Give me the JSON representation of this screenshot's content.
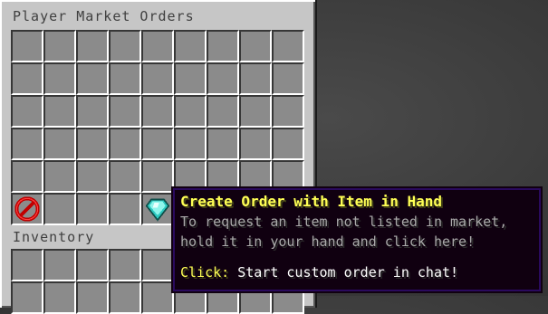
{
  "window": {
    "title": "Player Market Orders",
    "inventory_label": "Inventory"
  },
  "slots": {
    "barrier_slot": {
      "icon": "barrier-icon"
    },
    "create_order_slot": {
      "icon": "diamond-icon"
    }
  },
  "tooltip": {
    "title": "Create Order with Item in Hand",
    "lines": [
      "To request an item not listed in market,",
      "hold it in your hand and click here!"
    ],
    "click_key": "Click:",
    "click_value": " Start custom order in chat!",
    "colors": {
      "title": "#ffff55",
      "body": "#aaaaaa",
      "value": "#ffffff"
    }
  }
}
